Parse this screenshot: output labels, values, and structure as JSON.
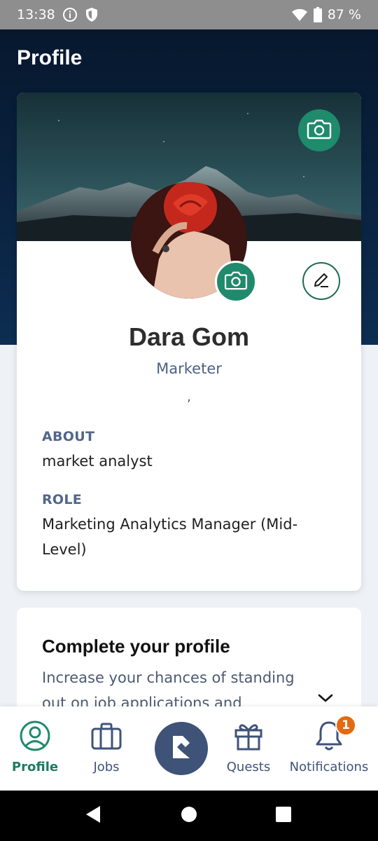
{
  "status_bar": {
    "time": "13:38",
    "battery": "87 %",
    "icons": [
      "info-icon",
      "shield-icon",
      "wifi-icon",
      "battery-icon"
    ]
  },
  "header": {
    "title": "Profile"
  },
  "profile": {
    "name": "Dara Gom",
    "title": "Marketer",
    "location": ",",
    "about_label": "ABOUT",
    "about_value": "market analyst",
    "role_label": "ROLE",
    "role_value": "Marketing Analytics Manager (Mid-Level)"
  },
  "complete_profile": {
    "title": "Complete your profile",
    "description": "Increase your chances of standing out on job applications and"
  },
  "bottom_nav": {
    "items": [
      {
        "label": "Profile",
        "icon": "user-circle-icon",
        "active": true
      },
      {
        "label": "Jobs",
        "icon": "briefcase-icon",
        "active": false
      },
      {
        "label": "",
        "icon": "app-logo-icon",
        "active": false
      },
      {
        "label": "Quests",
        "icon": "gift-icon",
        "active": false
      },
      {
        "label": "Notifications",
        "icon": "bell-icon",
        "active": false
      }
    ],
    "notification_count": "1"
  },
  "colors": {
    "accent_green": "#1f8a6c",
    "nav_blue": "#3f5378",
    "header_dark": "#07182e",
    "badge_orange": "#e36a10"
  }
}
